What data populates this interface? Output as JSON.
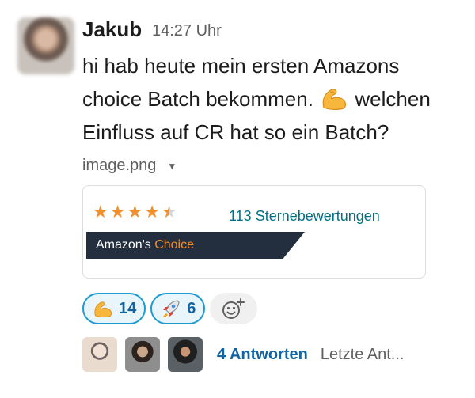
{
  "message": {
    "sender": "Jakub",
    "timestamp": "14:27 Uhr",
    "text_part1": "hi hab heute mein ersten Amazons choice Batch bekommen. ",
    "text_part2": " welchen Einfluss auf CR hat so ein Batch?"
  },
  "attachment": {
    "file_name": "image.png",
    "preview": {
      "rating_count": "113 Sternebewertungen",
      "badge_prefix": "Amazon's",
      "badge_suffix": "Choice",
      "rating": 4.5,
      "max_rating": 5
    }
  },
  "reactions": [
    {
      "emoji": "flexed-biceps-icon",
      "count": "14"
    },
    {
      "emoji": "rocket-icon",
      "count": "6"
    }
  ],
  "thread": {
    "reply_count_label": "4 Antworten",
    "last_reply_label": "Letzte Ant..."
  },
  "colors": {
    "link_blue": "#1264a3",
    "reaction_border": "#1d9bd1",
    "star_orange": "#f08f2c",
    "badge_dark": "#232f3e"
  }
}
